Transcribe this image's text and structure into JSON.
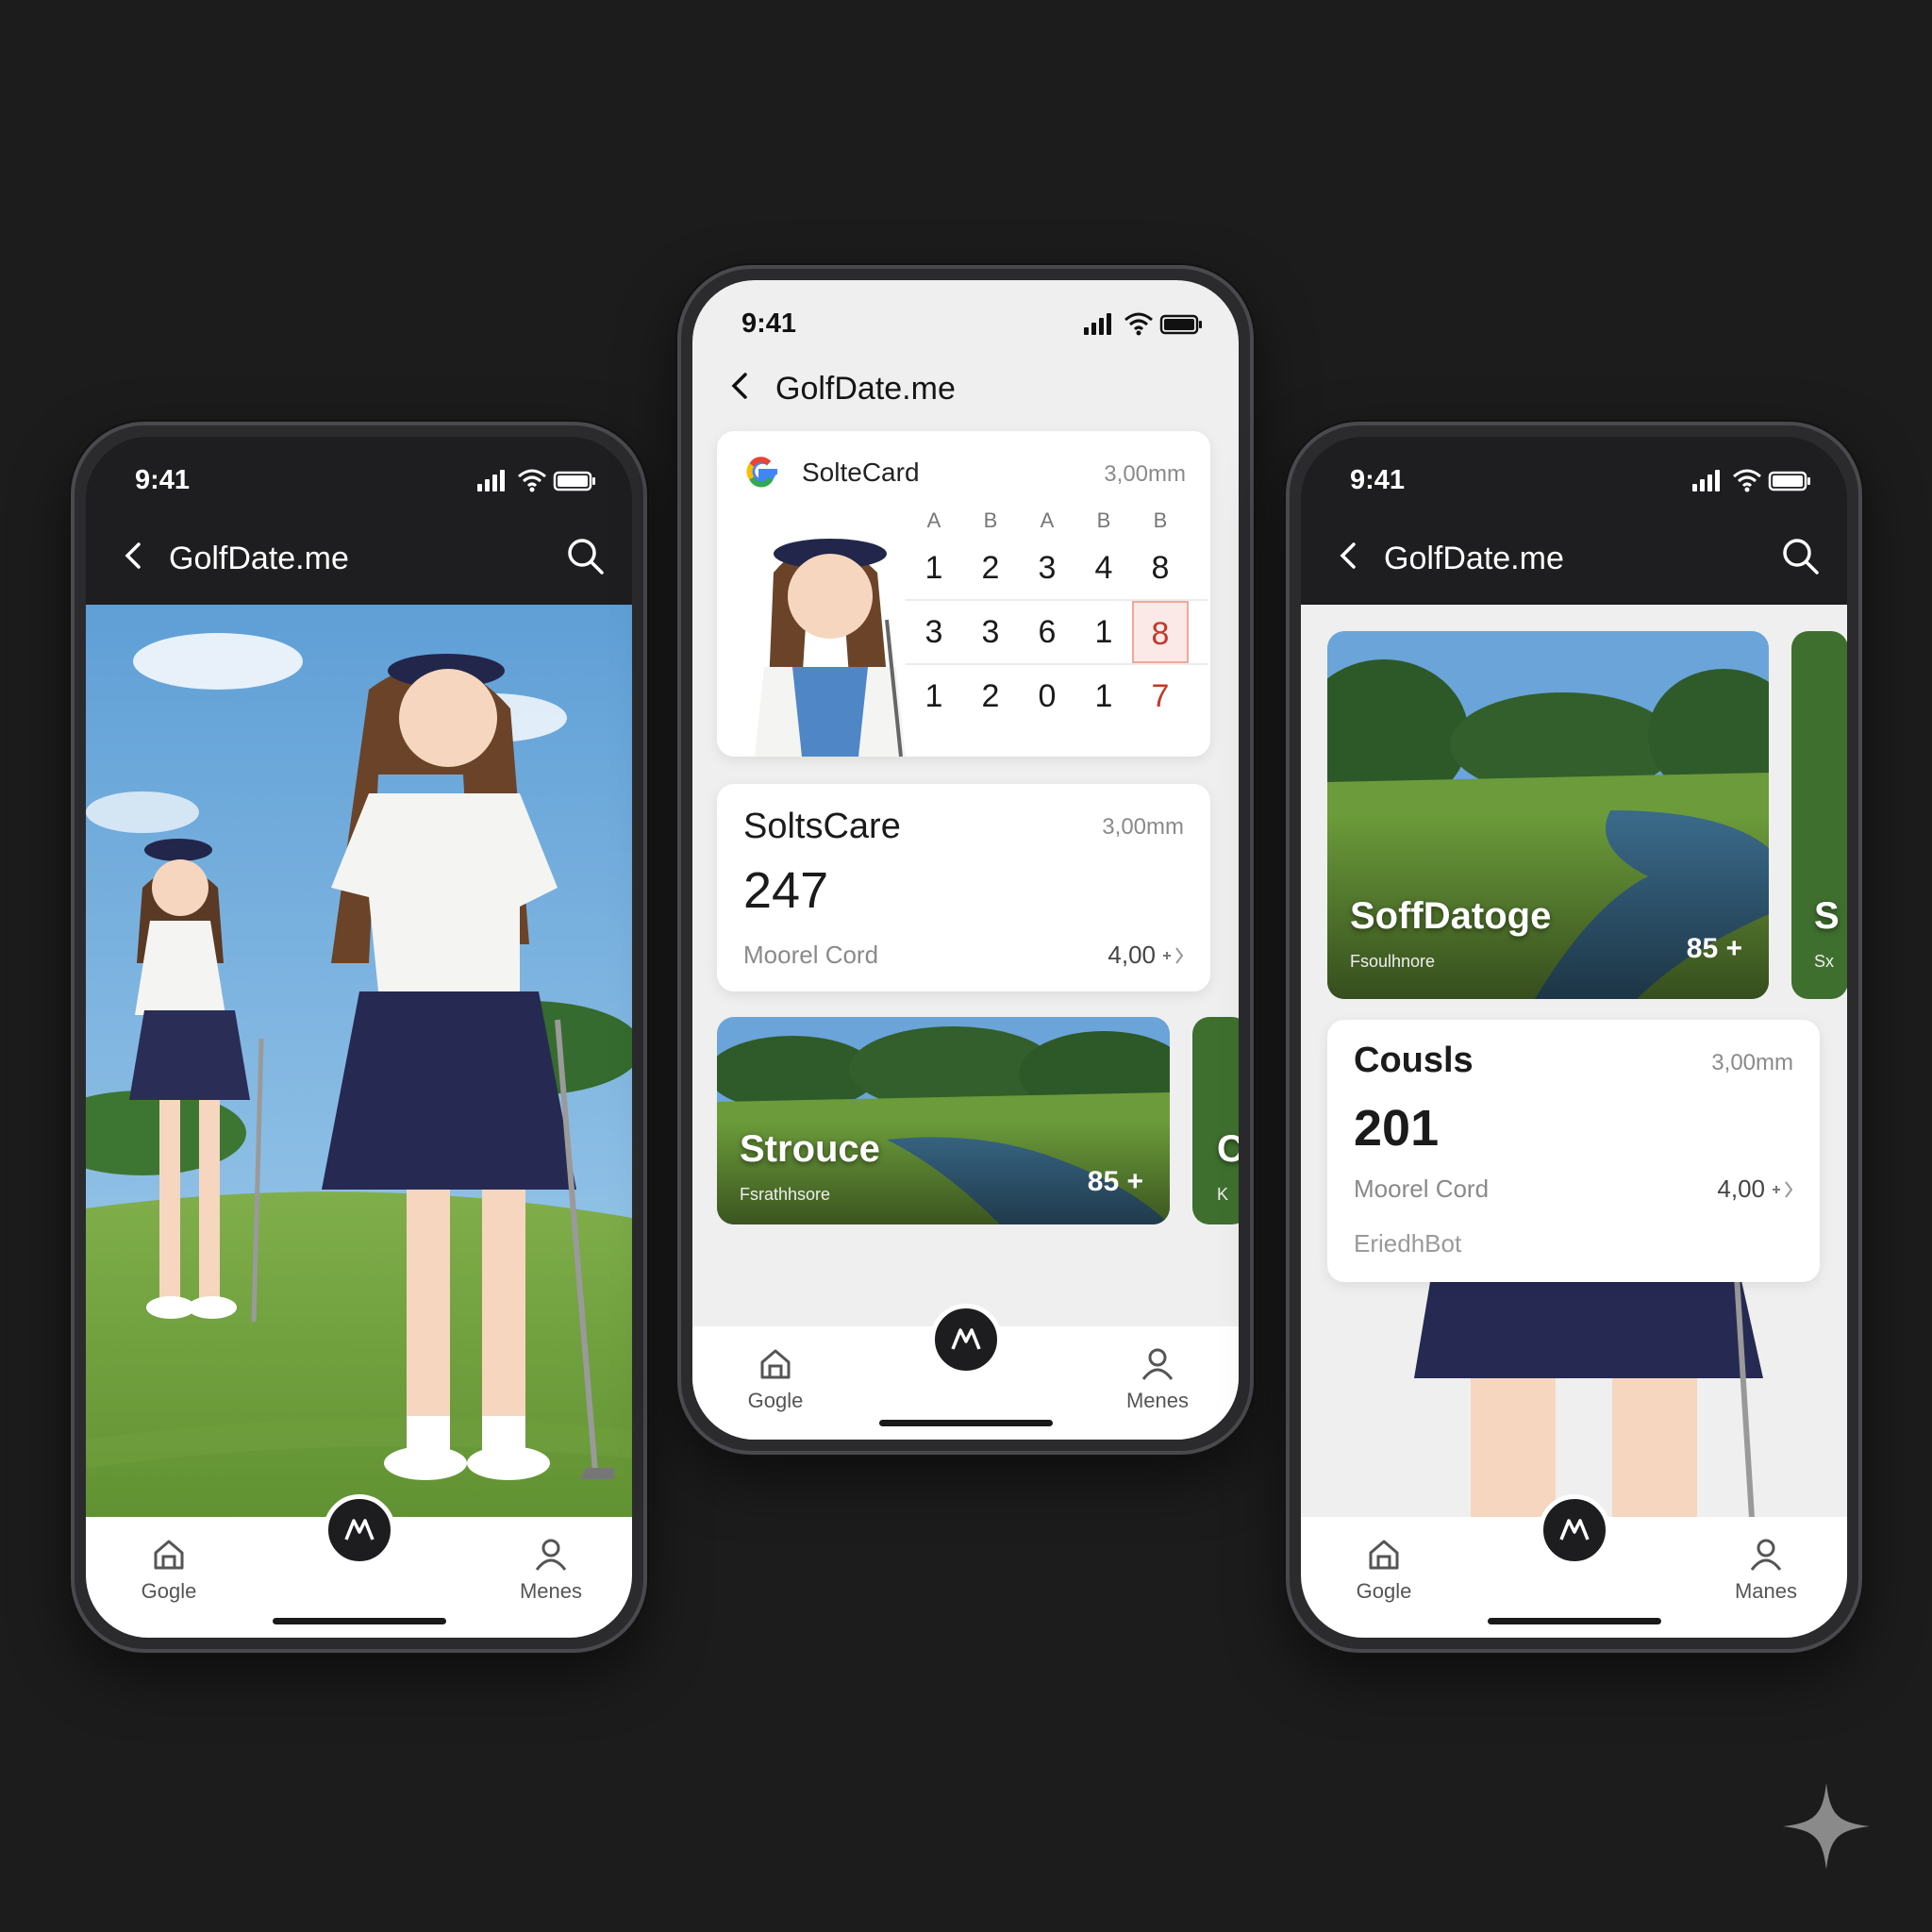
{
  "status": {
    "time": "9:41"
  },
  "app": {
    "title": "GolfDate.me"
  },
  "tabs": {
    "home_label": "Gogle",
    "profile_label": "Menes",
    "profile_label_alt": "Manes"
  },
  "phone2": {
    "scorecard": {
      "title": "SolteCard",
      "meta": "3,00mm",
      "header": [
        "A",
        "B",
        "A",
        "B",
        "B"
      ],
      "rows": [
        [
          "1",
          "2",
          "3",
          "4",
          "8"
        ],
        [
          "3",
          "3",
          "6",
          "1",
          "8"
        ],
        [
          "1",
          "2",
          "0",
          "1",
          "7"
        ]
      ]
    },
    "stats": {
      "title": "SoltsCare",
      "meta": "3,00mm",
      "value": "247",
      "subtitle": "Moorel Cord",
      "sub_value": "4,00"
    },
    "course": {
      "title": "Strouce",
      "subtitle": "Fsrathhsore",
      "count": "85 +",
      "peek_letter": "C",
      "peek_sub": "K"
    }
  },
  "phone3": {
    "course": {
      "title": "SoffDatoge",
      "subtitle": "Fsoulhnore",
      "count": "85 +",
      "peek_letter": "S",
      "peek_sub": "Sx"
    },
    "stats": {
      "title": "Cousls",
      "meta": "3,00mm",
      "value": "201",
      "subtitle": "Moorel Cord",
      "sub_value": "4,00",
      "footer": "EriedhBot"
    }
  },
  "colors": {
    "accent_red": "#c0392b",
    "background": "#1c1c1c",
    "fab": "#1d1d1f"
  },
  "icons": [
    "back-chevron-icon",
    "search-icon",
    "signal-icon",
    "wifi-icon",
    "battery-icon",
    "home-icon",
    "profile-icon",
    "motorola-logo-icon",
    "google-logo-icon",
    "sparkle-icon"
  ]
}
